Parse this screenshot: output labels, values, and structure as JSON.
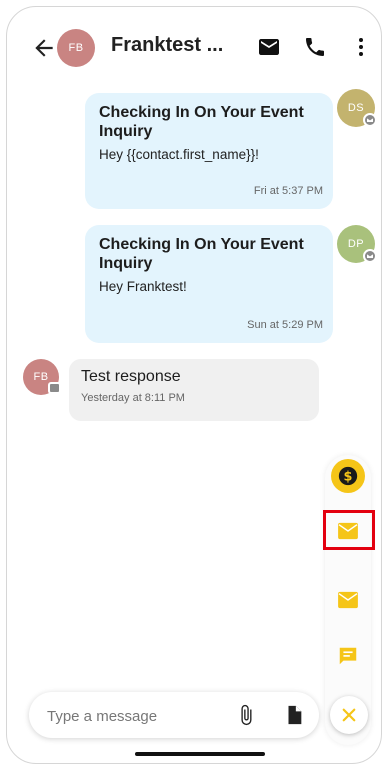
{
  "header": {
    "avatar_initials": "FB",
    "avatar_color": "#c98482",
    "title": "Franktest ...",
    "icons": [
      "back-arrow-icon",
      "mail-icon",
      "phone-icon",
      "more-vert-icon"
    ]
  },
  "messages": [
    {
      "direction": "outgoing",
      "title": "Checking In On Your Event Inquiry",
      "body": "Hey {{contact.first_name}}!",
      "time": "Fri at 5:37 PM",
      "sender_initials": "DS",
      "sender_color": "#c3b36e"
    },
    {
      "direction": "outgoing",
      "title": "Checking In On Your Event Inquiry",
      "body": "Hey Franktest!",
      "time": "Sun at 5:29 PM",
      "sender_initials": "DP",
      "sender_color": "#a9c17c"
    },
    {
      "direction": "incoming",
      "body": "Test response",
      "time": "Yesterday at 8:11 PM",
      "sender_initials": "FB",
      "sender_color": "#c98482"
    }
  ],
  "fab_menu": {
    "items": [
      "dollar-icon",
      "email-icon",
      "email-icon",
      "sms-icon"
    ],
    "highlighted_item": "email-icon",
    "accent_color": "#f5c518",
    "highlight_color": "#e3000f",
    "close_icon": "close-icon"
  },
  "composer": {
    "placeholder": "Type a message",
    "value": "",
    "icons": [
      "attachment-icon",
      "document-icon"
    ]
  }
}
